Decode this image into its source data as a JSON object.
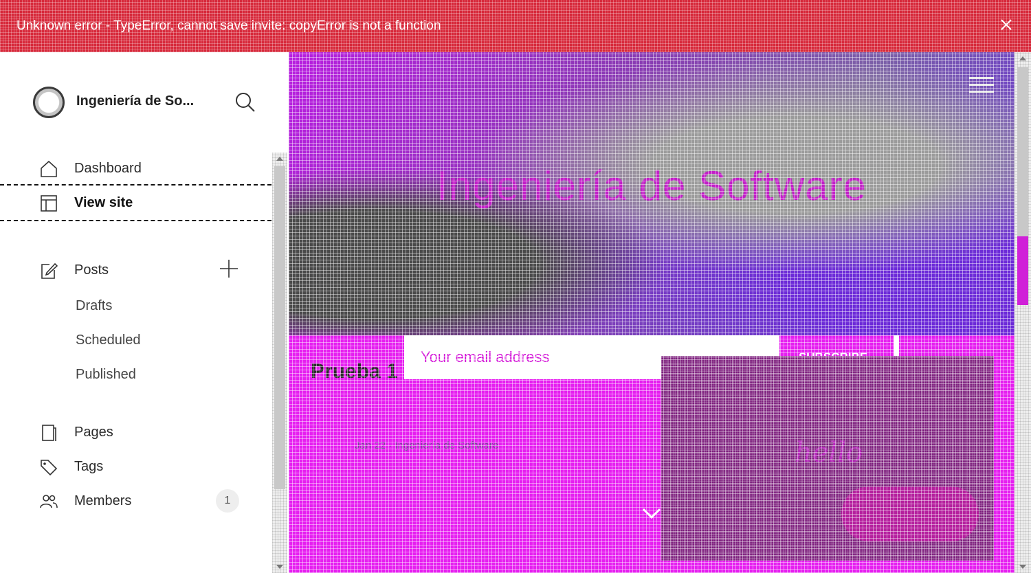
{
  "error": {
    "message": "Unknown error - TypeError, cannot save invite: copyError is not a function",
    "close_icon": "close-icon"
  },
  "sidebar": {
    "site_title": "Ingeniería de So...",
    "search_icon": "search-icon",
    "nav": [
      {
        "label": "Dashboard",
        "icon": "home-icon"
      },
      {
        "label": "View site",
        "icon": "layout-icon",
        "active": true
      }
    ],
    "posts": {
      "label": "Posts",
      "icon": "edit-icon",
      "add_icon": "plus-icon",
      "subitems": [
        "Drafts",
        "Scheduled",
        "Published"
      ]
    },
    "more": [
      {
        "label": "Pages",
        "icon": "pages-icon"
      },
      {
        "label": "Tags",
        "icon": "tag-icon"
      },
      {
        "label": "Members",
        "icon": "members-icon",
        "count": "1"
      }
    ]
  },
  "preview": {
    "hero_title": "Ingeniería de Software",
    "hero_subtitle": "",
    "email_placeholder": "Your email address",
    "subscribe_label": "SUBSCRIBE",
    "post_title": "Prueba 1",
    "post_meta": "Jan 22 · Ingeniería de Software",
    "popup_text": "hello",
    "colors": {
      "accent": "#e61ff0",
      "error_bar": "#d7283a",
      "popup_bg": "#7d1f7d"
    }
  }
}
